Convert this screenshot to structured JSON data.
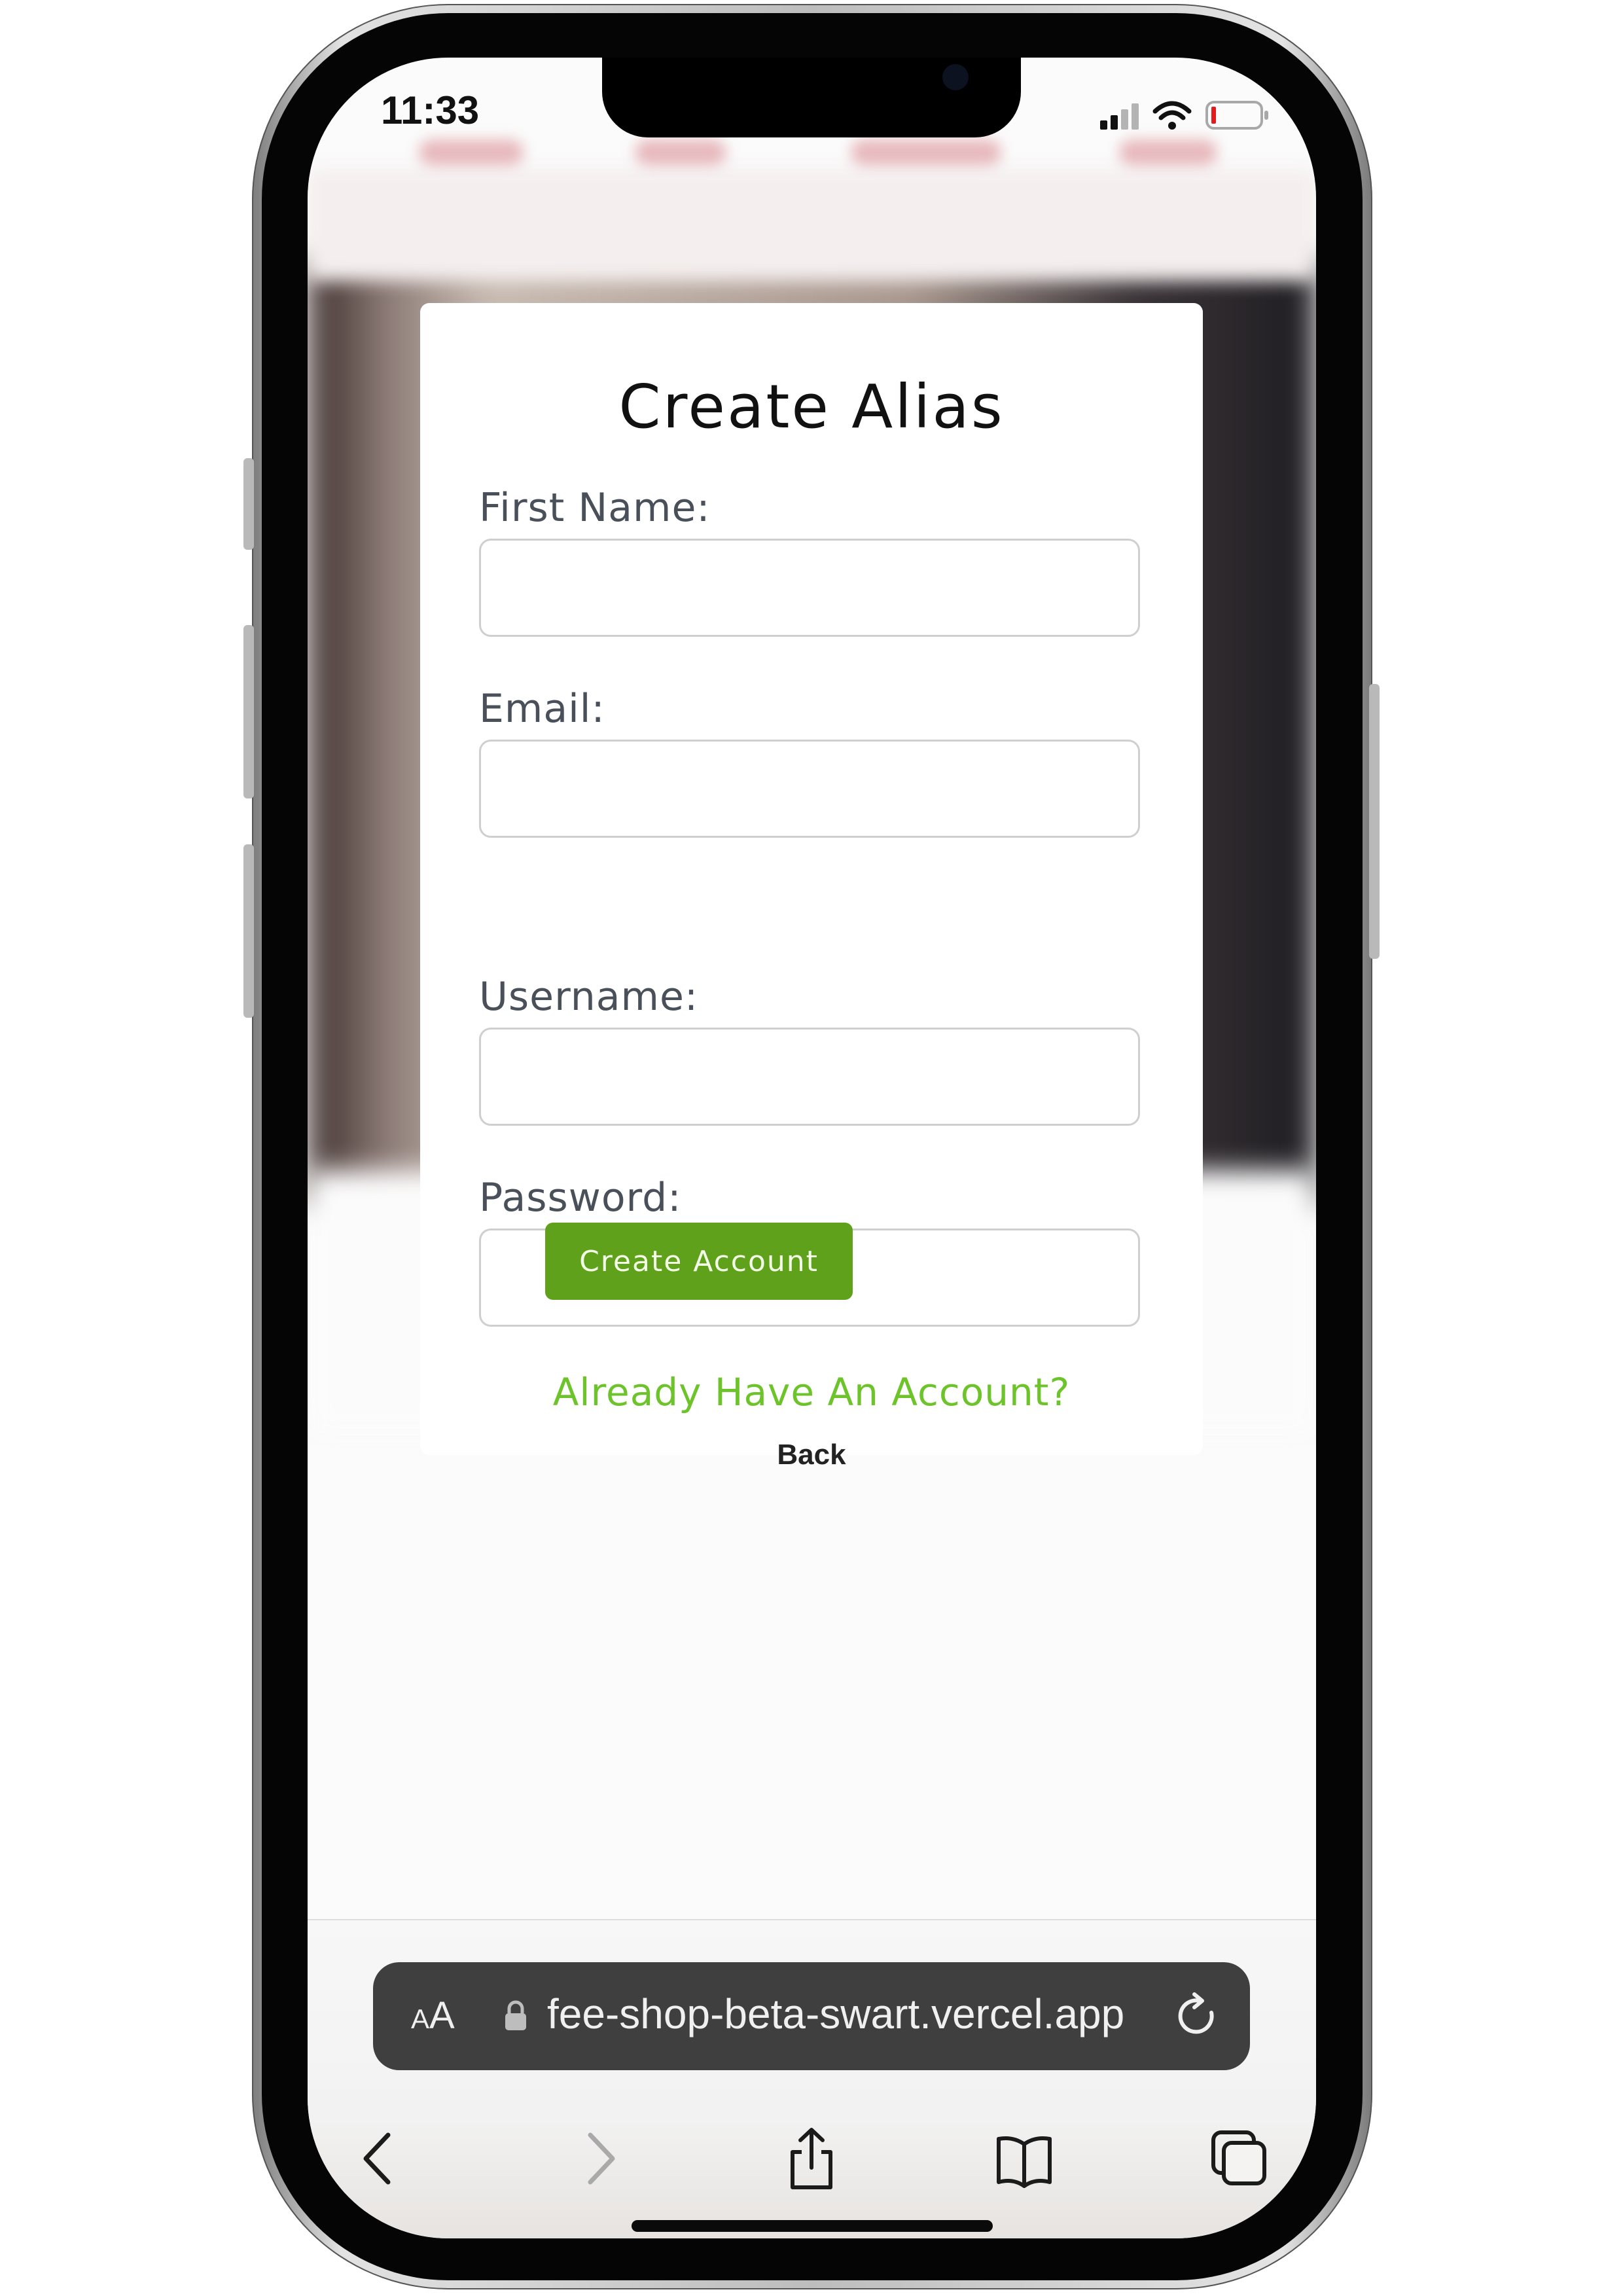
{
  "status_bar": {
    "time": "11:33",
    "icons": [
      "cellular-signal-icon",
      "wifi-icon",
      "battery-low-icon"
    ]
  },
  "modal": {
    "title": "Create Alias",
    "fields": [
      {
        "label": "First Name:",
        "value": ""
      },
      {
        "label": "Email:",
        "value": ""
      },
      {
        "label": "Username:",
        "value": ""
      },
      {
        "label": "Password:",
        "value": ""
      }
    ],
    "submit_label": "Create Account",
    "login_link": "Already Have An Account?",
    "back_link": "Back"
  },
  "safari": {
    "text_size_label_small": "A",
    "text_size_label_large": "A",
    "url": "fee-shop-beta-swart.vercel.app",
    "toolbar": [
      "back-icon",
      "forward-icon",
      "share-icon",
      "bookmarks-icon",
      "tabs-icon"
    ]
  },
  "colors": {
    "accent_green": "#5fa11a",
    "link_green": "#6cc32a",
    "url_bar_bg": "#3f3f3f"
  }
}
